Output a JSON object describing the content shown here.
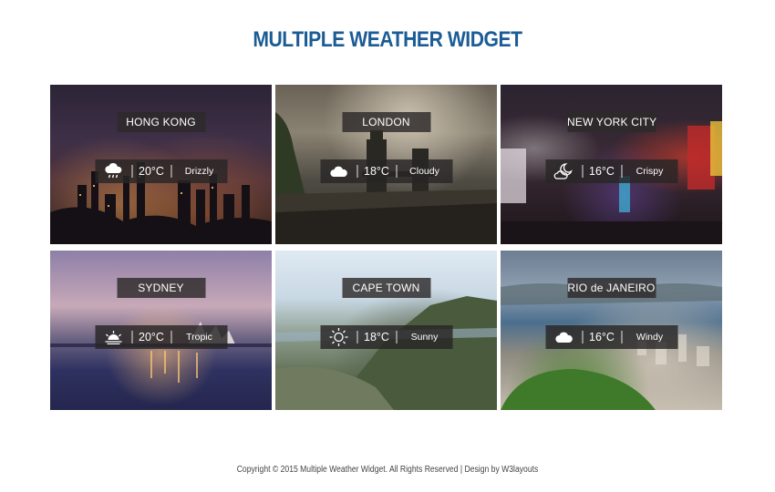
{
  "page": {
    "title": "MULTIPLE WEATHER WIDGET",
    "footer": "Copyright © 2015 Multiple Weather Widget. All Rights Reserved | Design by W3layouts"
  },
  "cities": [
    {
      "name": "HONG KONG",
      "temp": "20°C",
      "condition": "Drizzly",
      "icon": "cloud-rain-icon",
      "bg": "night-city-skyline"
    },
    {
      "name": "LONDON",
      "temp": "18°C",
      "condition": "Cloudy",
      "icon": "cloud-icon",
      "bg": "tower-bridge"
    },
    {
      "name": "NEW YORK CITY",
      "temp": "16°C",
      "condition": "Crispy",
      "icon": "moon-cloud-icon",
      "bg": "times-square"
    },
    {
      "name": "SYDNEY",
      "temp": "20°C",
      "condition": "Tropic",
      "icon": "sunrise-icon",
      "bg": "opera-house"
    },
    {
      "name": "CAPE TOWN",
      "temp": "18°C",
      "condition": "Sunny",
      "icon": "sun-icon",
      "bg": "table-mountain"
    },
    {
      "name": "RIO de JANEIRO",
      "temp": "16°C",
      "condition": "Windy",
      "icon": "cloud-icon",
      "bg": "rio-bay"
    }
  ],
  "colors": {
    "title": "#1b5c95",
    "panel": "#2d2a2a"
  }
}
